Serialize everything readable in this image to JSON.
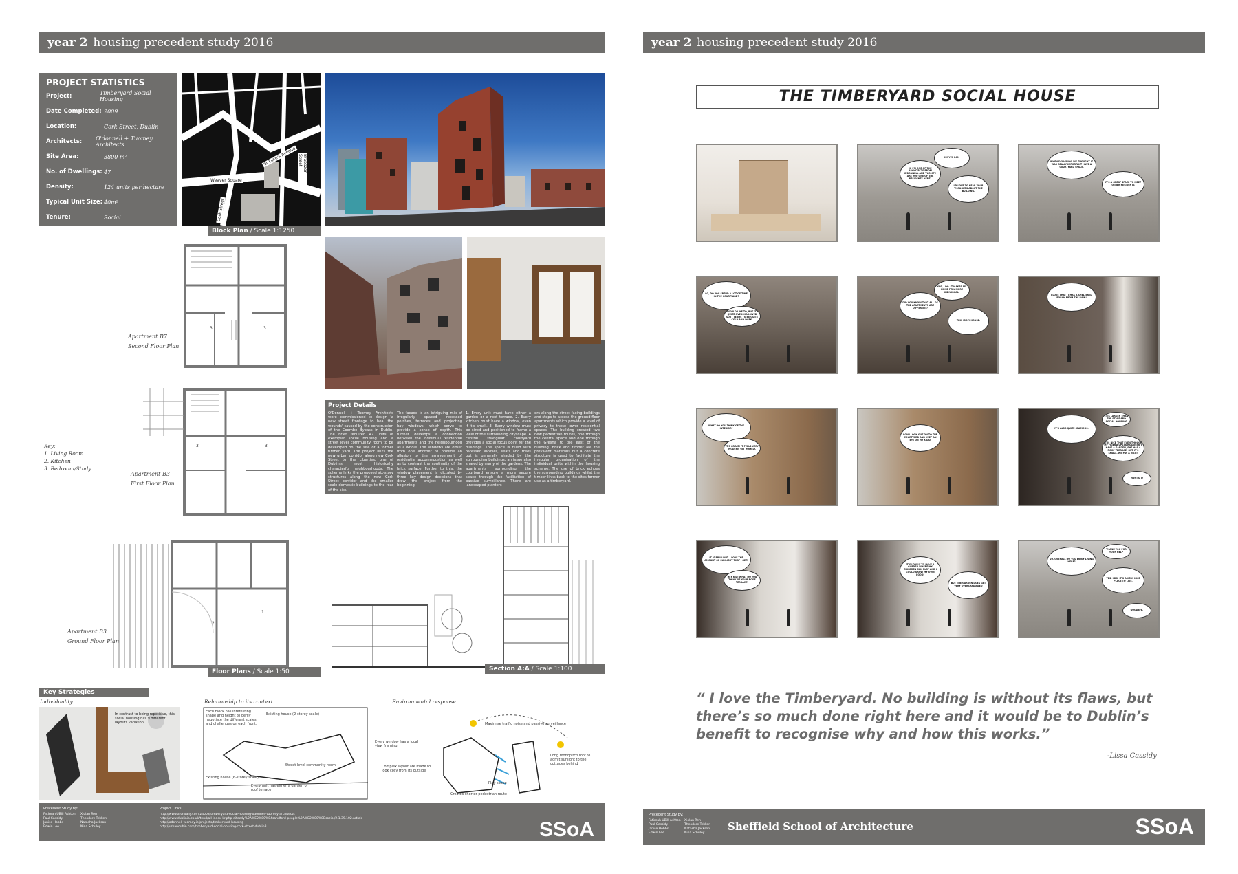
{
  "left_panel": {
    "header": {
      "year": "year 2",
      "title": "housing precedent study 2016"
    },
    "stats": {
      "heading": "PROJECT STATISTICS",
      "rows": [
        {
          "key": "Project:",
          "value": "Timberyard Social Housing"
        },
        {
          "key": "Date Completed:",
          "value": "2009"
        },
        {
          "key": "Location:",
          "value": "Cork Street, Dublin"
        },
        {
          "key": "Architects:",
          "value": "O'donnell + Tuomey Architects"
        },
        {
          "key": "Site Area:",
          "value": "3800 m²"
        },
        {
          "key": "No. of Dwellings:",
          "value": "47"
        },
        {
          "key": "Density:",
          "value": "124 units per hectare"
        },
        {
          "key": "Typical Unit Size:",
          "value": "40m²"
        },
        {
          "key": "Tenure:",
          "value": "Social"
        }
      ]
    },
    "map_labels": {
      "street1": "St Luke's Avenue",
      "street2": "Weaver Square",
      "street3": "Brabazon Street",
      "street4": "Cork Street"
    },
    "block_plan_caption": {
      "bold": "Block Plan",
      "rest": " / Scale 1:1250"
    },
    "plans": {
      "b7": {
        "line1": "Apartment B7",
        "line2": "Second Floor Plan"
      },
      "b3_first": {
        "line1": "Apartment B3",
        "line2": "First Floor Plan"
      },
      "b3_ground": {
        "line1": "Apartment B3",
        "line2": "Ground Floor Plan"
      },
      "key": {
        "title": "Key:",
        "items": [
          "1. Living Room",
          "2. Kitchen",
          "3. Bedroom/Study"
        ]
      },
      "room_numbers": [
        "3",
        "3",
        "3",
        "3",
        "2",
        "1"
      ]
    },
    "floor_plans_caption": {
      "bold": "Floor Plans",
      "rest": " / Scale 1:50"
    },
    "section_caption": {
      "bold": "Section A:A",
      "rest": " / Scale 1:100"
    },
    "project_details": {
      "heading": "Project Details",
      "columns": [
        "O'Donnell + Tuomey Architects were commissioned to design 'a new street frontage to heal the wounds' caused by the construction of the Coombe Bypass in Dublin. The brief required 47 units of exemplar social housing and a street level community room to be developed on the site of a former timber yard. The project links the new urban corridor along new Cork Street to the Liberties, one of Dublin's most historically characterful neighbourhoods. The scheme links the proposed six-story structures along the new Cork Street corridor and the smaller scale domestic buildings to the rear of the site.",
        "The facade is an intriguing mix of irregularly spaced recessed porches, terraces and projecting bay windows, which serve to provide a sense of depth. This further develops a connection between the individual residential apartments and the neighbourhood as a whole. The windows are offset from one another to provide an allusion to the arrangement of residential accommodation as well as to contrast the continuity of the brick surface. Further to this, the window placement is dictated by three key design decisions that drew the project from the beginning.",
        "1. Every unit must have either a garden or a roof terrace. 2. Every kitchen must have a window, even if it's small. 3. Every window must be sized and positioned to frame a view of the surrounding cityscape. A central triangular courtyard provides a social focus point for the buildings. The space is filled with recessed alcoves, seats and trees but is generally shaded by the surrounding buildings, an issue also shared by many of the gardens. The apartments surrounding the courtyard ensure a more secure space through the facilitation of passive surveillance. There are landscaped planters",
        "ers along the street facing buildings and steps to access the ground floor apartments which provide a level of privacy to these lower residential spaces. The building created two new pedestrian routes, one through the central space and one through the Gresha to the east of the building. Brick and timber are the prevalent materials but a concrete structure is used to facilitate the irregular organisation of the individual units within the housing scheme. The use of brick echoes the surrounding buildings whilst the timber links back to the sites former use as a timberyard."
      ]
    },
    "key_strategies": {
      "heading": "Key Strategies",
      "individuality": {
        "title": "Individuality",
        "note": "In contrast to being repetitive, this social housing has 9 different layouts variation"
      },
      "context": {
        "title": "Relationship to its context",
        "notes": [
          "Each block has interesting shape and height to defily negotiate the different scales and challenges on each front.",
          "Existing house (2-storey scale)",
          "Street level community room",
          "Existing house (6-storey scale)",
          "Every unit has either a garden or roof terrace"
        ]
      },
      "environment": {
        "title": "Environmental response",
        "notes": [
          "Maximise traffic noise and passive surveillance",
          "Every window has a local view framing",
          "Complex layout are made to look cosy from its outside",
          "Long monopitch roof to admit sunlight to the cottages behind",
          "Play space",
          "Creates shorter pedestrian route"
        ]
      }
    },
    "footer": {
      "study_by_title": "Precedent Study by:",
      "names_col1": [
        "Fatimah UBill Ashton",
        "Paul Cassidy",
        "Janise Hobbs",
        "Edwin Lee"
      ],
      "names_col2": [
        "Xiolan Ren",
        "Theodore Tekken",
        "Natasha Jackson",
        "Nina Schuley"
      ],
      "links_title": "Project Links:",
      "links": [
        "http://www.archdaily.com/24008/timberyard-social-housing-odonnell-tuomey-architects",
        "http://www.dublinia.co.uk/tend/all-index-kr.php-ditectly%2A%E2%80%84sandford-people%2A%E2%80%8Bsocial/2.1.39.102.article",
        "http://odonnell-tuomey.ie/projects/timberyard-housing",
        "http://urbandubin.com/timberyard-social-housing-cork-street-dublin8"
      ],
      "logo": "SSoA"
    }
  },
  "right_panel": {
    "header": {
      "year": "year 2",
      "title": "housing precedent study 2016"
    },
    "title": "THE TIMBERYARD SOCIAL HOUSE",
    "quote": "“ I love the Timberyard. No building is without its flaws, but there’s so much done right here and it would be to Dublin’s benefit to recognise why and how this works.”",
    "attribution": "-Lissa Cassidy",
    "footer": {
      "study_by_title": "Precedent Study by:",
      "names_col1": [
        "Fatimah UBill Ashton",
        "Paul Cassidy",
        "Janise Hobbs",
        "Edwin Lee"
      ],
      "names_col2": [
        "Xiolan Ren",
        "Theodore Tekken",
        "Natasha Jackson",
        "Nina Schuley"
      ],
      "school": "Sheffield School of Architecture",
      "logo": "SSoA"
    },
    "storyboard": [
      {
        "scene": "model",
        "bubbles": []
      },
      {
        "scene": "street",
        "bubbles": [
          "HI I'M ONE OF THE ARCHITECTS FROM O'DONNELL AND TUOMEY. ARE YOU ONE OF THE RESIDENTS HERE?",
          "I'D LOVE TO HEAR YOUR THOUGHTS ABOUT THE BUILDING.",
          "HI! YES I AM"
        ]
      },
      {
        "scene": "street",
        "bubbles": [
          "WHEN DESIGNING WE THOUGHT IT WAS REALLY IMPORTANT HAVE A COURTYARD SPACE.",
          "IT'S A GREAT SPACE TO MEET OTHER RESIDENTS"
        ]
      },
      {
        "scene": "courtyard",
        "bubbles": [
          "SO, DO YOU SPEND A LOT OF TIME IN THE COURTYARD?",
          "I WOULD LIKE TO, BUT IT'S QUITE OVERSHADOWED SO IT TENDS TO BE QUITE COLD AND DARK."
        ]
      },
      {
        "scene": "courtyard",
        "bubbles": [
          "DID YOU KNOW THAT ALL OF THE APARTMENTS ARE DIFFERENT?",
          "THIS IS MY HOUSE.",
          "YES, I DO. IT MAKES MY HOME FEEL MORE INDIVIDUAL."
        ]
      },
      {
        "scene": "door",
        "bubbles": [
          "I LOVE THAT IT HAS A SHELTERED PORCH FROM THE RAIN!"
        ]
      },
      {
        "scene": "interior",
        "bubbles": [
          "WHAT DO YOU THINK OF THE INTERIOR?",
          "IT'S GREAT! IT FEELS VERY MODERN YET HOMELY."
        ]
      },
      {
        "scene": "interior",
        "bubbles": [
          "I CAN LOOK OUT ON TO THE COURTYARD AND KEEP AN EYE ON MY KIDS!"
        ]
      },
      {
        "scene": "interior-dark",
        "bubbles": [
          "IT'S ALSO QUITE SPACIOUS.",
          "IT IS NICE THAT EVEN THOUGH MY FRIEND UPSTAIRS DOESN'T HAVE A GARDEN, SHE HAS A ROOF TERRACE! BUT IT'S SMALL. WE PAY A VISIT!",
          "IT IS LARGER THAN THE STANDARD SOCIAL HOUSING",
          "MAY I SIT?"
        ]
      },
      {
        "scene": "interior-light",
        "bubbles": [
          "IT IS BRILLIANT. I LOVE THE AMOUNT OF SUNLIGHT THAT I GET!",
          "HEY KID! WHAT DO YOU THINK OF YOUR ROOF TERRACE?"
        ]
      },
      {
        "scene": "interior-light",
        "bubbles": [
          "IT'S LOVELY TO HAVE A GARDEN WHERE MY CHILDREN CAN PLAY AND I COULD GROW MY OWN FOOD!",
          "BUT THE GARDEN DOES GET VERY OVERSHADOWED"
        ]
      },
      {
        "scene": "street",
        "bubbles": [
          "SO, OVERALL DO YOU ENJOY LIVING HERE?",
          "YES, I DO. IT'S A VERY NICE PLACE TO LIVE.",
          "THANK YOU FOR YOUR HELP",
          "GOODBYE."
        ]
      }
    ]
  }
}
